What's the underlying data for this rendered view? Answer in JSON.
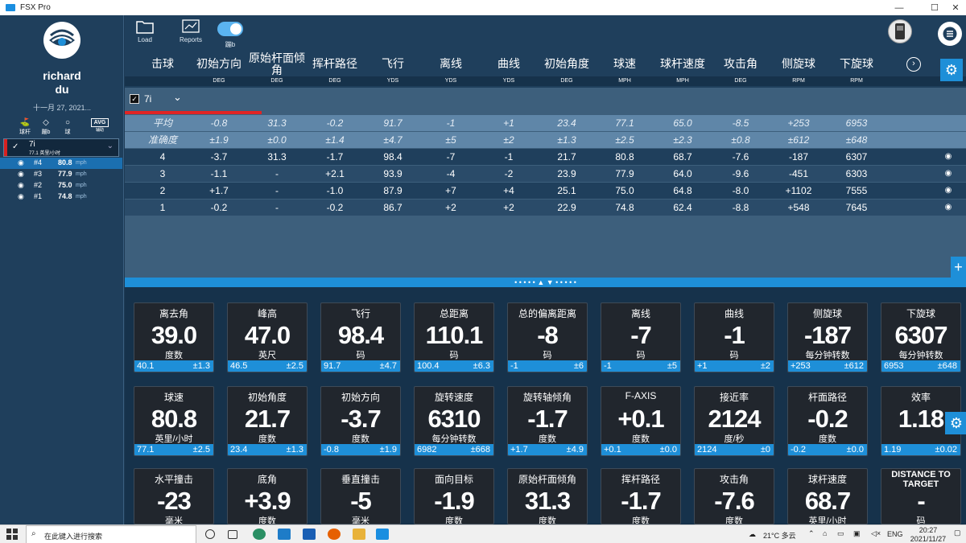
{
  "window": {
    "title": "FSX Pro",
    "controls": [
      "—",
      "☐",
      "✕"
    ]
  },
  "sidebar": {
    "user_first": "richard",
    "user_last": "du",
    "date": "十一月 27, 2021...",
    "tabs": [
      {
        "label": "球杆",
        "icon": "club-icon"
      },
      {
        "label": "蹦b",
        "icon": "tag-icon"
      },
      {
        "label": "球",
        "icon": "ball-icon"
      },
      {
        "label": "AVG",
        "sub": "辅助"
      }
    ],
    "club": {
      "name": "7i",
      "sub": "77.1 英里/小时"
    },
    "shots": [
      {
        "label": "#4",
        "speed": "80.8",
        "unit": "mph"
      },
      {
        "label": "#3",
        "speed": "77.9",
        "unit": "mph"
      },
      {
        "label": "#2",
        "speed": "75.0",
        "unit": "mph"
      },
      {
        "label": "#1",
        "speed": "74.8",
        "unit": "mph"
      }
    ]
  },
  "toolbar": {
    "load": "Load",
    "reports": "Reports",
    "toggle_label": "蹦b"
  },
  "table": {
    "headers": [
      "击球",
      "初始方向",
      "原始杆面倾角",
      "挥杆路径",
      "飞行",
      "离线",
      "曲线",
      "初始角度",
      "球速",
      "球杆速度",
      "攻击角",
      "侧旋球",
      "下旋球"
    ],
    "units": [
      "",
      "DEG",
      "DEG",
      "DEG",
      "YDS",
      "YDS",
      "YDS",
      "DEG",
      "MPH",
      "MPH",
      "DEG",
      "RPM",
      "RPM"
    ],
    "club": "7i",
    "average": [
      "平均",
      "-0.8",
      "31.3",
      "-0.2",
      "91.7",
      "-1",
      "+1",
      "23.4",
      "77.1",
      "65.0",
      "-8.5",
      "+253",
      "6953"
    ],
    "accuracy": [
      "准确度",
      "±1.9",
      "±0.0",
      "±1.4",
      "±4.7",
      "±5",
      "±2",
      "±1.3",
      "±2.5",
      "±2.3",
      "±0.8",
      "±612",
      "±648"
    ],
    "rows": [
      [
        "4",
        "-3.7",
        "31.3",
        "-1.7",
        "98.4",
        "-7",
        "-1",
        "21.7",
        "80.8",
        "68.7",
        "-7.6",
        "-187",
        "6307"
      ],
      [
        "3",
        "-1.1",
        "-",
        "+2.1",
        "93.9",
        "-4",
        "-2",
        "23.9",
        "77.9",
        "64.0",
        "-9.6",
        "-451",
        "6303"
      ],
      [
        "2",
        "+1.7",
        "-",
        "-1.0",
        "87.9",
        "+7",
        "+4",
        "25.1",
        "75.0",
        "64.8",
        "-8.0",
        "+1102",
        "7555"
      ],
      [
        "1",
        "-0.2",
        "-",
        "-0.2",
        "86.7",
        "+2",
        "+2",
        "22.9",
        "74.8",
        "62.4",
        "-8.8",
        "+548",
        "7645"
      ]
    ]
  },
  "tiles": [
    [
      {
        "label": "离去角",
        "value": "39.0",
        "unit": "度数",
        "avg": "40.1",
        "acc": "±1.3"
      },
      {
        "label": "峰高",
        "value": "47.0",
        "unit": "英尺",
        "avg": "46.5",
        "acc": "±2.5"
      },
      {
        "label": "飞行",
        "value": "98.4",
        "unit": "码",
        "avg": "91.7",
        "acc": "±4.7"
      },
      {
        "label": "总距离",
        "value": "110.1",
        "unit": "码",
        "avg": "100.4",
        "acc": "±6.3"
      },
      {
        "label": "总的偏离距离",
        "value": "-8",
        "unit": "码",
        "avg": "-1",
        "acc": "±6"
      },
      {
        "label": "离线",
        "value": "-7",
        "unit": "码",
        "avg": "-1",
        "acc": "±5"
      },
      {
        "label": "曲线",
        "value": "-1",
        "unit": "码",
        "avg": "+1",
        "acc": "±2"
      },
      {
        "label": "侧旋球",
        "value": "-187",
        "unit": "每分钟转数",
        "avg": "+253",
        "acc": "±612"
      },
      {
        "label": "下旋球",
        "value": "6307",
        "unit": "每分钟转数",
        "avg": "6953",
        "acc": "±648"
      }
    ],
    [
      {
        "label": "球速",
        "value": "80.8",
        "unit": "英里/小时",
        "avg": "77.1",
        "acc": "±2.5"
      },
      {
        "label": "初始角度",
        "value": "21.7",
        "unit": "度数",
        "avg": "23.4",
        "acc": "±1.3"
      },
      {
        "label": "初始方向",
        "value": "-3.7",
        "unit": "度数",
        "avg": "-0.8",
        "acc": "±1.9"
      },
      {
        "label": "旋转速度",
        "value": "6310",
        "unit": "每分钟转数",
        "avg": "6982",
        "acc": "±668"
      },
      {
        "label": "旋转轴倾角",
        "value": "-1.7",
        "unit": "度数",
        "avg": "+1.7",
        "acc": "±4.9"
      },
      {
        "label": "F-AXIS",
        "value": "+0.1",
        "unit": "度数",
        "avg": "+0.1",
        "acc": "±0.0"
      },
      {
        "label": "接近率",
        "value": "2124",
        "unit": "度/秒",
        "avg": "2124",
        "acc": "±0"
      },
      {
        "label": "杆面路径",
        "value": "-0.2",
        "unit": "度数",
        "avg": "-0.2",
        "acc": "±0.0"
      },
      {
        "label": "效率",
        "value": "1.18",
        "unit": "",
        "avg": "1.19",
        "acc": "±0.02"
      }
    ],
    [
      {
        "label": "水平撞击",
        "value": "-23",
        "unit": "毫米"
      },
      {
        "label": "底角",
        "value": "+3.9",
        "unit": "度数"
      },
      {
        "label": "垂直撞击",
        "value": "-5",
        "unit": "毫米"
      },
      {
        "label": "面向目标",
        "value": "-1.9",
        "unit": "度数"
      },
      {
        "label": "原始杆面倾角",
        "value": "31.3",
        "unit": "度数"
      },
      {
        "label": "挥杆路径",
        "value": "-1.7",
        "unit": "度数"
      },
      {
        "label": "攻击角",
        "value": "-7.6",
        "unit": "度数"
      },
      {
        "label": "球杆速度",
        "value": "68.7",
        "unit": "英里/小时"
      },
      {
        "label": "DISTANCE TO TARGET",
        "value": "-",
        "unit": "码"
      }
    ]
  ],
  "taskbar": {
    "search_placeholder": "在此键入进行搜索",
    "weather": "21°C 多云",
    "lang": "ENG",
    "time": "20:27",
    "date": "2021/11/27"
  },
  "colors": {
    "accent": "#1e8fd8",
    "red": "#e02424",
    "tile_bg": "#21262d"
  }
}
